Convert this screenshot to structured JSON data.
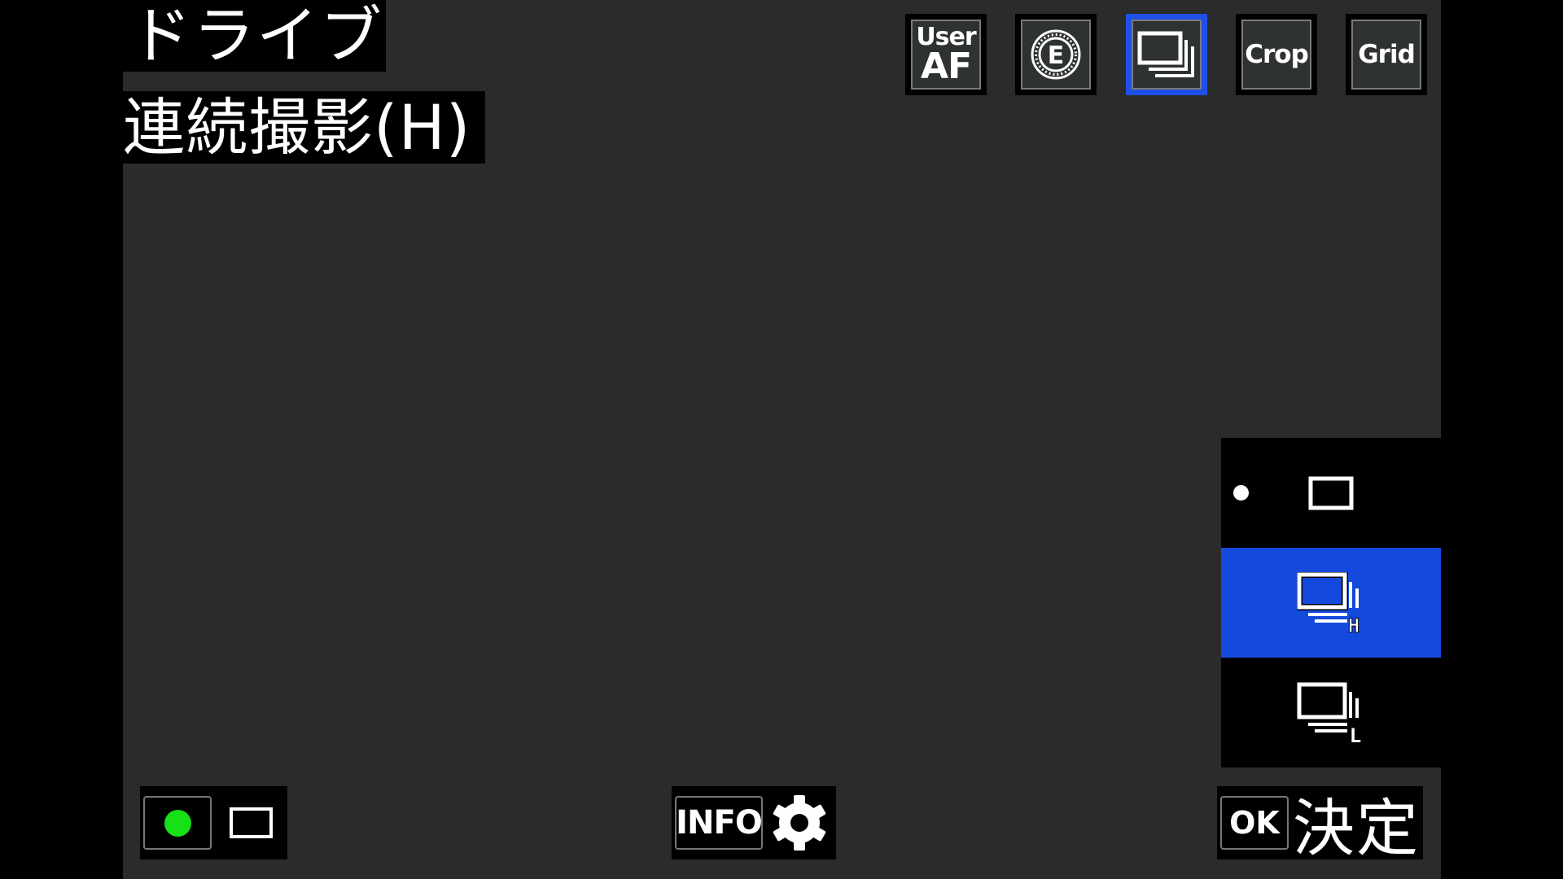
{
  "header": {
    "title": "ドライブ",
    "subtitle": "連続撮影(H)"
  },
  "top_buttons": [
    {
      "id": "user-af",
      "line1": "User",
      "line2": "AF",
      "active": false
    },
    {
      "id": "e-mode",
      "icon": "e-circle-icon",
      "active": false
    },
    {
      "id": "drive",
      "icon": "continuous-shooting-icon",
      "active": true
    },
    {
      "id": "crop",
      "label": "Crop",
      "active": false
    },
    {
      "id": "grid",
      "label": "Grid",
      "active": false
    }
  ],
  "drive_options": [
    {
      "name": "single-shot",
      "icon": "single-frame-icon",
      "current": true,
      "selected": false
    },
    {
      "name": "continuous-high",
      "icon": "continuous-high-icon",
      "badge": "H",
      "current": false,
      "selected": true
    },
    {
      "name": "continuous-low",
      "icon": "continuous-low-icon",
      "badge": "L",
      "current": false,
      "selected": false
    }
  ],
  "footer": {
    "record_indicator_color": "#16e016",
    "info_label": "INFO",
    "ok_key": "OK",
    "ok_action": "決定"
  },
  "colors": {
    "accent": "#1449dd",
    "background": "#2b2b2b"
  }
}
